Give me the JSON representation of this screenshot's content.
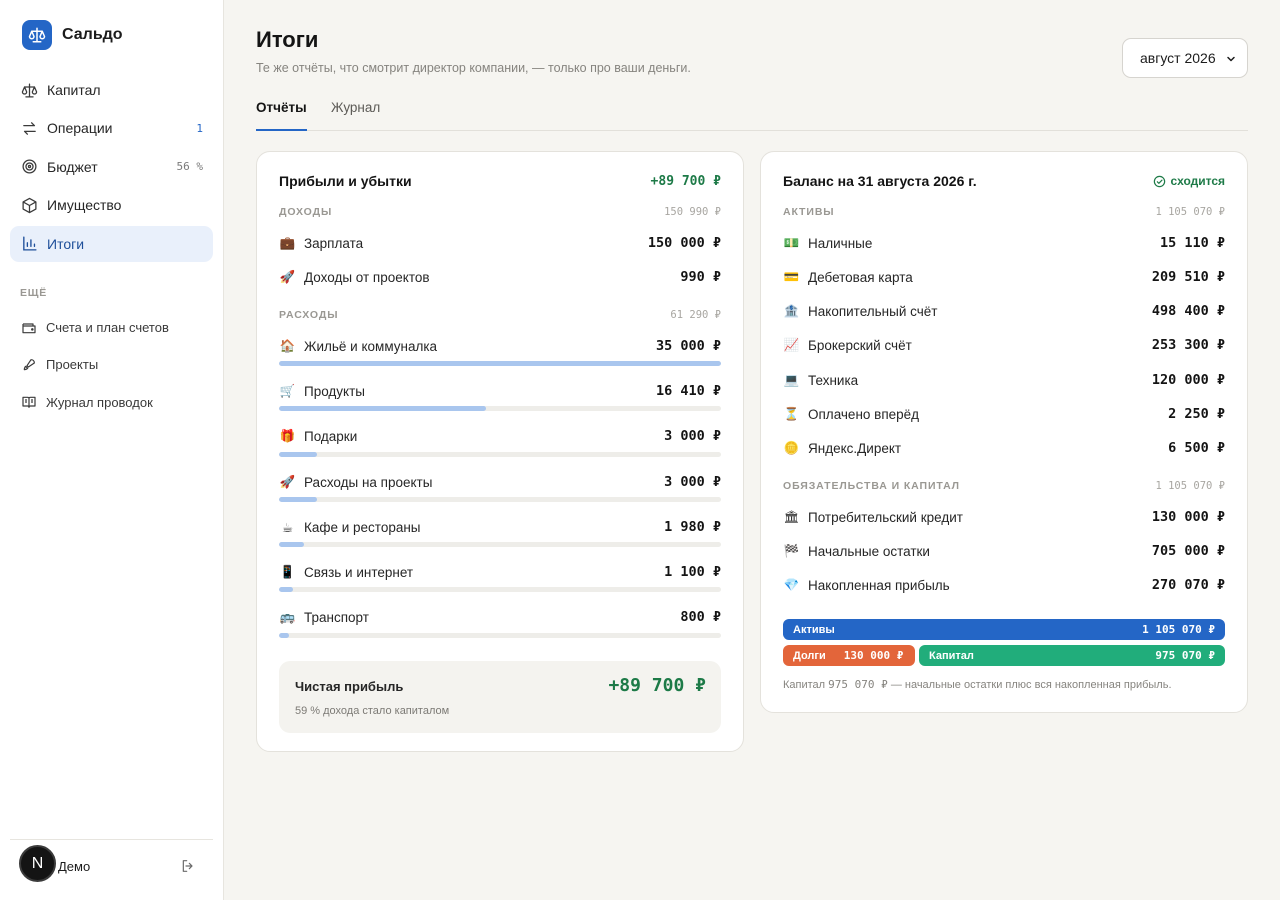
{
  "app": {
    "name": "Сальдо",
    "user_initial": "N",
    "user_name": "Демо"
  },
  "nav": [
    {
      "label": "Капитал",
      "count": ""
    },
    {
      "label": "Операции",
      "count": "1"
    },
    {
      "label": "Бюджет",
      "count": "56 %"
    },
    {
      "label": "Имущество",
      "count": ""
    },
    {
      "label": "Итоги",
      "count": ""
    }
  ],
  "nav_more_title": "ЕЩЁ",
  "nav_more": [
    "Счета и план счетов",
    "Проекты",
    "Журнал проводок"
  ],
  "header": {
    "title": "Итоги",
    "subtitle": "Те же отчёты, что смотрит директор компании, — только про ваши деньги.",
    "period": "август 2026"
  },
  "tabs": [
    "Отчёты",
    "Журнал"
  ],
  "pnl": {
    "title": "Прибыли и убытки",
    "total": "+89 700 ₽",
    "income_label": "ДОХОДЫ",
    "income_sum": "150 990 ₽",
    "income": [
      {
        "emoji": "💼",
        "label": "Зарплата",
        "amount": "150 000 ₽"
      },
      {
        "emoji": "🚀",
        "label": "Доходы от проектов",
        "amount": "990 ₽"
      }
    ],
    "expense_label": "РАСХОДЫ",
    "expense_sum": "61 290 ₽",
    "expenses": [
      {
        "emoji": "🏠",
        "label": "Жильё и коммуналка",
        "amount": "35 000 ₽",
        "share": 1.0
      },
      {
        "emoji": "🛒",
        "label": "Продукты",
        "amount": "16 410 ₽",
        "share": 0.469
      },
      {
        "emoji": "🎁",
        "label": "Подарки",
        "amount": "3 000 ₽",
        "share": 0.086
      },
      {
        "emoji": "🚀",
        "label": "Расходы на проекты",
        "amount": "3 000 ₽",
        "share": 0.086
      },
      {
        "emoji": "☕",
        "label": "Кафе и рестораны",
        "amount": "1 980 ₽",
        "share": 0.057
      },
      {
        "emoji": "📱",
        "label": "Связь и интернет",
        "amount": "1 100 ₽",
        "share": 0.031
      },
      {
        "emoji": "🚌",
        "label": "Транспорт",
        "amount": "800 ₽",
        "share": 0.023
      }
    ],
    "net_label": "Чистая прибыль",
    "net_value": "+89 700 ₽",
    "net_note": "59 % дохода стало капиталом"
  },
  "balance": {
    "title": "Баланс на 31 августа 2026 г.",
    "status": "сходится",
    "assets_label": "АКТИВЫ",
    "assets_sum": "1 105 070 ₽",
    "assets": [
      {
        "emoji": "💵",
        "label": "Наличные",
        "amount": "15 110 ₽"
      },
      {
        "emoji": "💳",
        "label": "Дебетовая карта",
        "amount": "209 510 ₽"
      },
      {
        "emoji": "🏦",
        "label": "Накопительный счёт",
        "amount": "498 400 ₽"
      },
      {
        "emoji": "📈",
        "label": "Брокерский счёт",
        "amount": "253 300 ₽"
      },
      {
        "emoji": "💻",
        "label": "Техника",
        "amount": "120 000 ₽"
      },
      {
        "emoji": "⏳",
        "label": "Оплачено вперёд",
        "amount": "2 250 ₽"
      },
      {
        "emoji": "🪙",
        "label": "Яндекс.Директ",
        "amount": "6 500 ₽"
      }
    ],
    "liab_label": "ОБЯЗАТЕЛЬСТВА И КАПИТАЛ",
    "liab_sum": "1 105 070 ₽",
    "liabilities": [
      {
        "emoji": "🏛",
        "label": "Потребительский кредит",
        "amount": "130 000 ₽"
      },
      {
        "emoji": "🏁",
        "label": "Начальные остатки",
        "amount": "705 000 ₽"
      },
      {
        "emoji": "💎",
        "label": "Накопленная прибыль",
        "amount": "270 070 ₽"
      }
    ],
    "bar_assets_label": "Активы",
    "bar_assets_value": "1 105 070 ₽",
    "bar_debt_label": "Долги",
    "bar_debt_value": "130 000 ₽",
    "bar_capital_label": "Капитал",
    "bar_capital_value": "975 070 ₽",
    "note_prefix": "Капитал",
    "note_value": "975 070 ₽",
    "note_suffix": "— начальные остатки плюс вся накопленная прибыль."
  },
  "colors": {
    "accent": "#2466c6",
    "positive": "#1d7a47",
    "debt": "#e3653a",
    "capital": "#21ad7b",
    "bar": "#a9c6ee"
  }
}
